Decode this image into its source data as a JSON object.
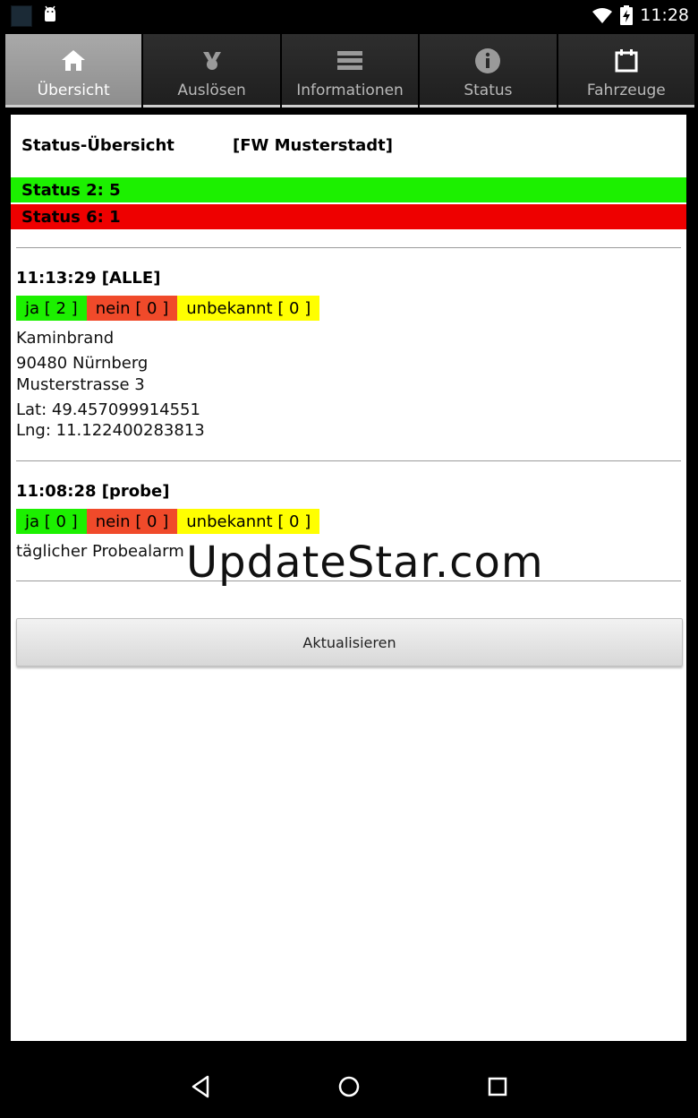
{
  "statusbar": {
    "time": "11:28"
  },
  "tabs": [
    {
      "label": "Übersicht",
      "icon": "home-icon",
      "active": true
    },
    {
      "label": "Auslösen",
      "icon": "trigger-icon",
      "active": false
    },
    {
      "label": "Informationen",
      "icon": "list-icon",
      "active": false
    },
    {
      "label": "Status",
      "icon": "info-icon",
      "active": false
    },
    {
      "label": "Fahrzeuge",
      "icon": "vehicle-icon",
      "active": false
    }
  ],
  "overview": {
    "title": "Status-Übersicht",
    "station": "[FW Musterstadt]",
    "status_lines": [
      {
        "text": "Status 2: 5",
        "color": "#1cf000"
      },
      {
        "text": "Status 6: 1",
        "color": "#ee0000"
      }
    ]
  },
  "alarms": [
    {
      "title": "11:13:29 [ALLE]",
      "ja": "ja [ 2 ]",
      "nein": "nein [ 0 ]",
      "unbekannt": "unbekannt [ 0 ]",
      "keyword": "Kaminbrand",
      "city": "90480 Nürnberg",
      "street": "Musterstrasse 3",
      "lat": "Lat: 49.457099914551",
      "lng": "Lng: 11.122400283813"
    },
    {
      "title": "11:08:28 [probe]",
      "ja": "ja [ 0 ]",
      "nein": "nein [ 0 ]",
      "unbekannt": "unbekannt [ 0 ]",
      "keyword": "täglicher Probealarm"
    }
  ],
  "refresh_button": "Aktualisieren",
  "watermark": "UpdateStar.com"
}
